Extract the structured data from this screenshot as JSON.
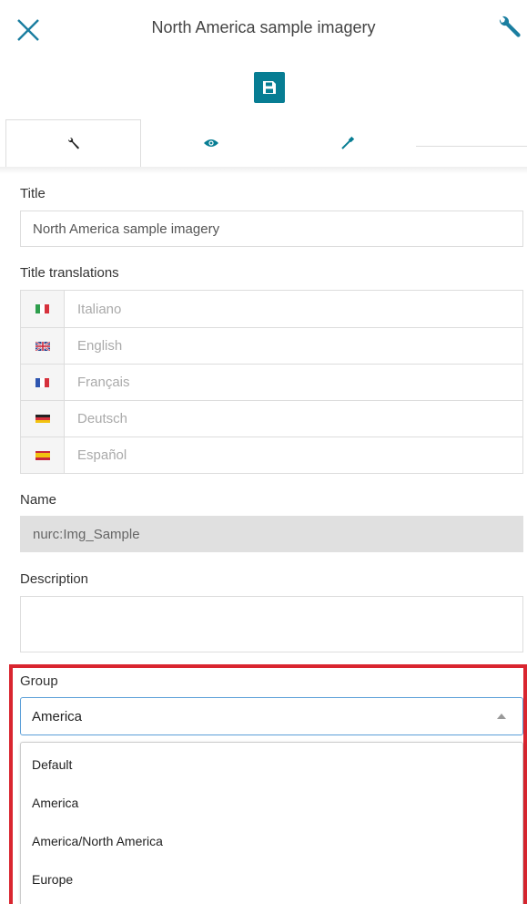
{
  "header": {
    "title": "North America sample imagery"
  },
  "toolbar": {
    "save_icon": "floppy-disk-icon"
  },
  "tabs": [
    {
      "icon": "wrench-icon",
      "active": true
    },
    {
      "icon": "eye-icon",
      "active": false
    },
    {
      "icon": "eyedropper-icon",
      "active": false
    }
  ],
  "form": {
    "title_label": "Title",
    "title_value": "North America sample imagery",
    "translations_label": "Title translations",
    "translations": [
      {
        "flag": "italy-flag-icon",
        "placeholder": "Italiano"
      },
      {
        "flag": "uk-flag-icon",
        "placeholder": "English"
      },
      {
        "flag": "france-flag-icon",
        "placeholder": "Français"
      },
      {
        "flag": "germany-flag-icon",
        "placeholder": "Deutsch"
      },
      {
        "flag": "spain-flag-icon",
        "placeholder": "Español"
      }
    ],
    "name_label": "Name",
    "name_value": "nurc:Img_Sample",
    "description_label": "Description",
    "description_value": "",
    "group_label": "Group",
    "group_value": "America",
    "group_options": [
      "Default",
      "America",
      "America/North America",
      "Europe"
    ]
  },
  "colors": {
    "accent": "#077d93",
    "highlight_border": "#d9252f",
    "select_focus_border": "#5b9fd8"
  }
}
